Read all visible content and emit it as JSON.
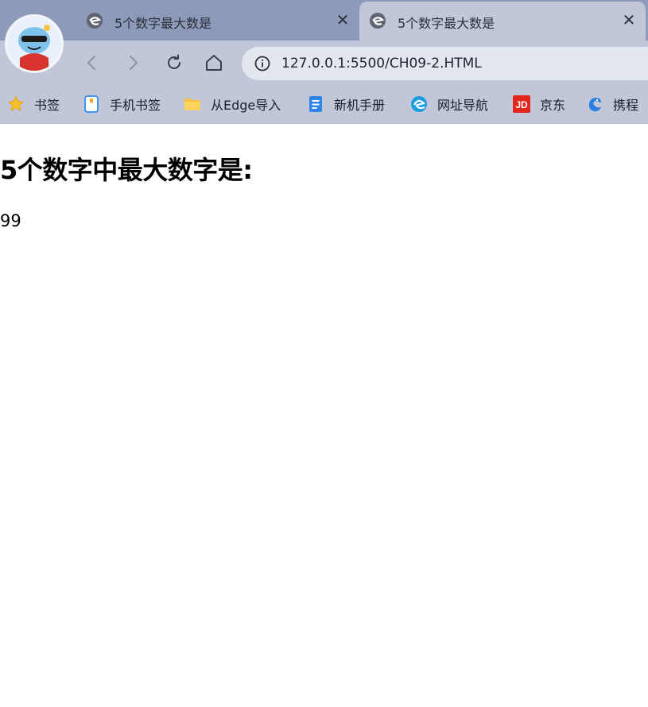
{
  "browser": {
    "tabs": [
      {
        "title": "5个数字最大数是",
        "active": false
      },
      {
        "title": "5个数字最大数是",
        "active": true
      }
    ],
    "address_bar": {
      "url": "127.0.0.1:5500/CH09-2.HTML"
    },
    "bookmarks": [
      {
        "label": "书签",
        "icon": "star-icon"
      },
      {
        "label": "手机书签",
        "icon": "phone-bookmark-icon"
      },
      {
        "label": "从Edge导入",
        "icon": "folder-icon"
      },
      {
        "label": "新机手册",
        "icon": "manual-icon"
      },
      {
        "label": "网址导航",
        "icon": "edge-icon"
      },
      {
        "label": "京东",
        "icon": "jd-icon"
      },
      {
        "label": "携程",
        "icon": "ctrip-icon"
      }
    ],
    "colors": {
      "tabstrip": "#8e9ab9",
      "toolbar": "#c1c7d8",
      "urlbar": "#e3e7ef"
    }
  },
  "page": {
    "heading": "5个数字中最大数字是:",
    "result": "99"
  }
}
